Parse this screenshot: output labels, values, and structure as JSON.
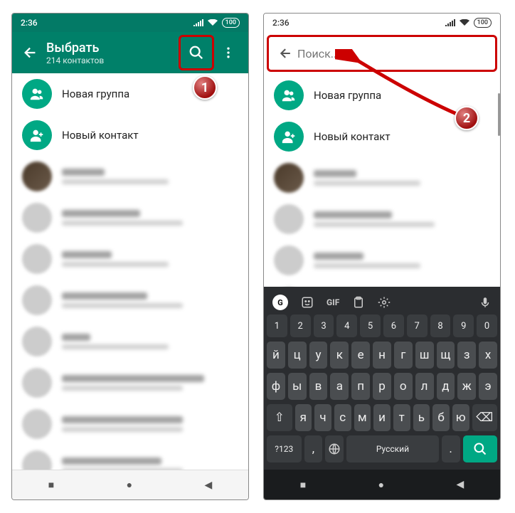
{
  "status": {
    "time": "2:36",
    "battery": "100"
  },
  "appbar": {
    "title": "Выбрать",
    "subtitle": "214 контактов"
  },
  "search": {
    "placeholder": "Поиск..."
  },
  "items": {
    "newGroup": "Новая группа",
    "newContact": "Новый контакт"
  },
  "keyboard": {
    "numbers": [
      "1",
      "2",
      "3",
      "4",
      "5",
      "6",
      "7",
      "8",
      "9",
      "0"
    ],
    "row1": [
      "й",
      "ц",
      "у",
      "к",
      "е",
      "н",
      "г",
      "ш",
      "щ",
      "з",
      "х"
    ],
    "row2": [
      "ф",
      "ы",
      "в",
      "а",
      "п",
      "р",
      "о",
      "л",
      "д",
      "ж",
      "э"
    ],
    "row3": [
      "я",
      "ч",
      "с",
      "м",
      "и",
      "т",
      "ь",
      "б",
      "ю"
    ],
    "shift": "⇧",
    "backspace": "⌫",
    "symbols": "?123",
    "comma": ",",
    "space": "Русский",
    "period": "."
  },
  "callouts": {
    "one": "1",
    "two": "2"
  },
  "suggest": {
    "gif": "GIF"
  }
}
